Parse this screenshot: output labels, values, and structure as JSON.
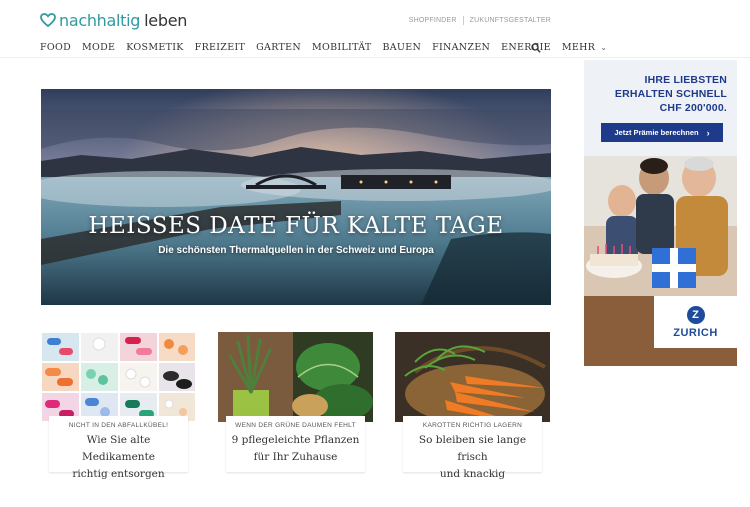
{
  "header": {
    "logo_part1": "nachhaltig",
    "logo_part2": "leben",
    "top_links": [
      "SHOPFINDER",
      "ZUKUNFTSGESTALTER"
    ]
  },
  "nav": {
    "items": [
      "FOOD",
      "MODE",
      "KOSMETIK",
      "FREIZEIT",
      "GARTEN",
      "MOBILITÄT",
      "BAUEN",
      "FINANZEN",
      "ENERGIE",
      "MEHR"
    ],
    "search_icon": "search-icon"
  },
  "hero": {
    "title": "HEISSES DATE FÜR KALTE TAGE",
    "subtitle": "Die schönsten Thermalquellen in der Schweiz und Europa"
  },
  "cards": [
    {
      "kicker": "NICHT IN DEN ABFALLKÜBEL!",
      "title_line1": "Wie Sie alte Medikamente",
      "title_line2": "richtig entsorgen"
    },
    {
      "kicker": "WENN DER GRÜNE DAUMEN FEHLT",
      "title_line1": "9 pflegeleichte Pflanzen",
      "title_line2": "für Ihr Zuhause"
    },
    {
      "kicker": "KAROTTEN RICHTIG LAGERN",
      "title_line1": "So bleiben sie lange frisch",
      "title_line2": "und knackig"
    }
  ],
  "ad": {
    "headline_line1": "IHRE LIEBSTEN",
    "headline_line2": "ERHALTEN SCHNELL",
    "headline_line3": "CHF 200'000.",
    "button_label": "Jetzt Prämie berechnen",
    "brand": "ZURICH",
    "brand_mark": "Z"
  },
  "colors": {
    "brand_teal": "#2f9aa0",
    "ad_blue": "#1e3a8a",
    "zurich_blue": "#1e4c9a"
  }
}
